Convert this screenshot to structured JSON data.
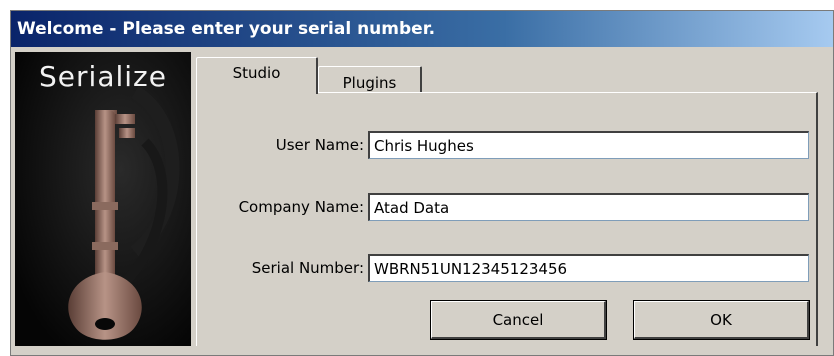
{
  "window": {
    "title": "Welcome - Please enter your serial number."
  },
  "splash": {
    "title": "Serialize",
    "icon": "key-icon"
  },
  "tabs": [
    {
      "label": "Studio",
      "active": true
    },
    {
      "label": "Plugins",
      "active": false
    }
  ],
  "form": {
    "user_name_label": "User Name:",
    "user_name_value": "Chris Hughes",
    "company_name_label": "Company Name:",
    "company_name_value": "Atad Data",
    "serial_number_label": "Serial Number:",
    "serial_number_value": "WBRN51UN12345123456"
  },
  "buttons": {
    "cancel": "Cancel",
    "ok": "OK"
  }
}
